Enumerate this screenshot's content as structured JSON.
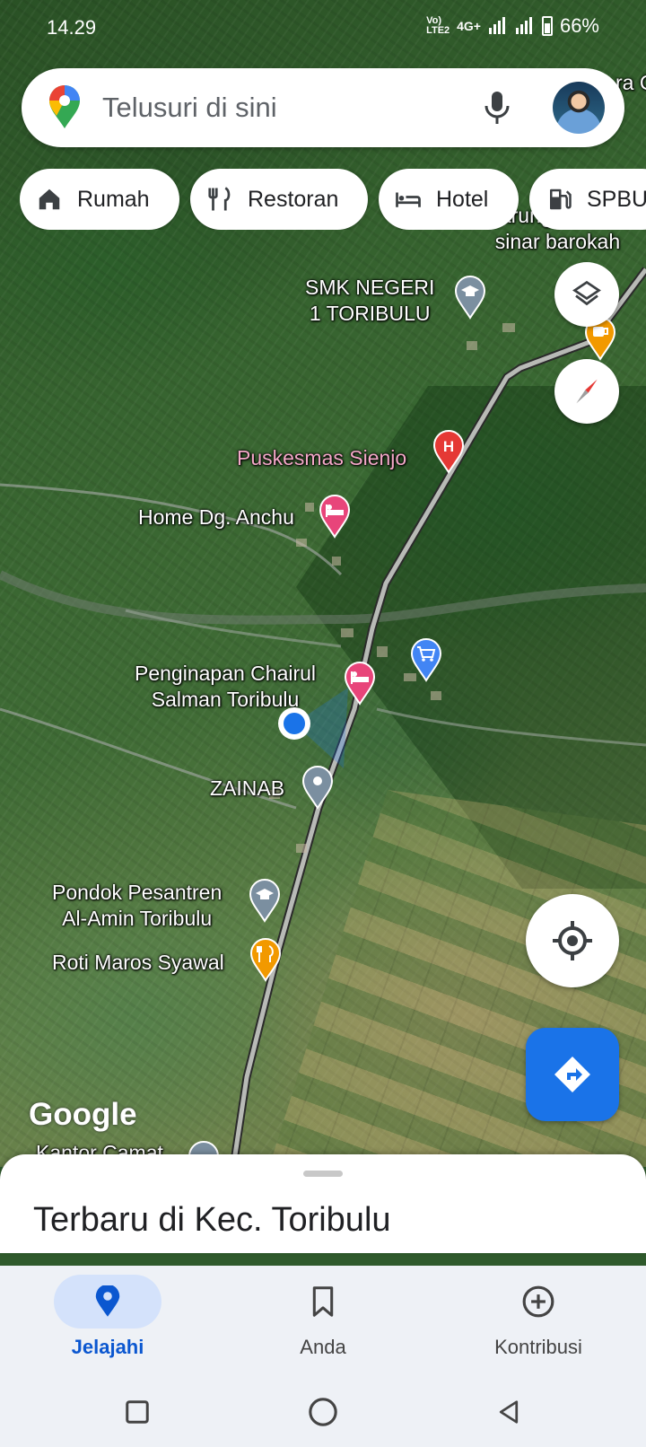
{
  "status_bar": {
    "time": "14.29",
    "volte": "Vo) LTE2",
    "network": "4G+",
    "battery": "66%"
  },
  "search": {
    "placeholder": "Telusuri di sini"
  },
  "chips": [
    {
      "label": "Rumah",
      "icon": "home-icon"
    },
    {
      "label": "Restoran",
      "icon": "restaurant-icon"
    },
    {
      "label": "Hotel",
      "icon": "hotel-icon"
    },
    {
      "label": "SPBU",
      "icon": "gas-station-icon"
    }
  ],
  "map": {
    "labels": {
      "warung": "Warung Makan\nsinar barokah",
      "smk": "SMK NEGERI\n1 TORIBULU",
      "puskesmas": "Puskesmas Sienjo",
      "home": "Home Dg. Anchu",
      "penginapan": "Penginapan Chairul\nSalman Toribulu",
      "zainab": "ZAINAB",
      "pondok": "Pondok Pesantren\nAl-Amin Toribulu",
      "roti": "Roti Maros Syawal",
      "kantor": "Kantor Camat",
      "corner": "ra C"
    },
    "attribution": "Google",
    "colors": {
      "road": "#b8bab6",
      "pin_pink": "#e8457a",
      "pin_red": "#e53935",
      "pin_blue": "#4285f4",
      "pin_orange": "#f29900",
      "pin_gray": "#7b8fa0",
      "location_dot": "#1a73e8"
    }
  },
  "bottom_sheet": {
    "title": "Terbaru di Kec. Toribulu"
  },
  "bottom_nav": [
    {
      "label": "Jelajahi",
      "icon": "explore-pin-icon",
      "active": true
    },
    {
      "label": "Anda",
      "icon": "bookmark-icon",
      "active": false
    },
    {
      "label": "Kontribusi",
      "icon": "add-circle-icon",
      "active": false
    }
  ]
}
